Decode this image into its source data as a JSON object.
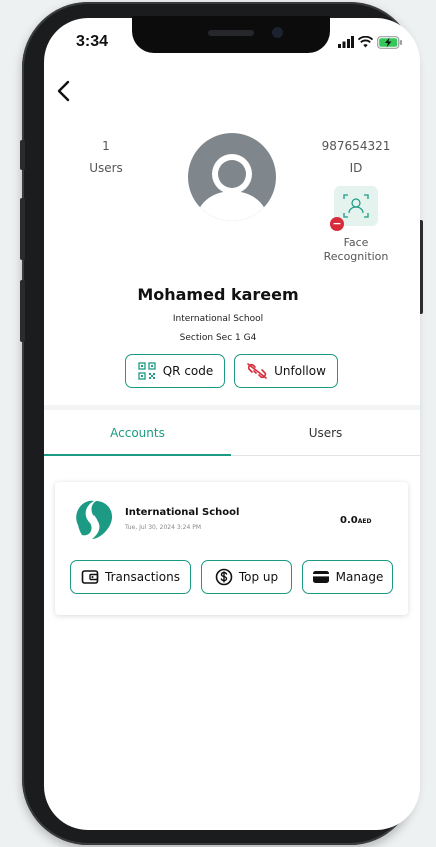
{
  "status": {
    "time": "3:34"
  },
  "profile": {
    "users_count": "1",
    "users_label": "Users",
    "id_value": "987654321",
    "id_label": "ID",
    "face_label_1": "Face",
    "face_label_2": "Recognition",
    "name": "Mohamed kareem",
    "school": "International School",
    "section": "Section  Sec 1 G4"
  },
  "actions": {
    "qr_label": "QR code",
    "unfollow_label": "Unfollow"
  },
  "tabs": [
    {
      "label": "Accounts",
      "active": true
    },
    {
      "label": "Users",
      "active": false
    }
  ],
  "account_card": {
    "title": "International School",
    "date": "Tue, Jul 30, 2024 3:24 PM",
    "amount": "0.0",
    "currency": "AED",
    "buttons": {
      "transactions": "Transactions",
      "top_up": "Top up",
      "manage": "Manage"
    }
  },
  "colors": {
    "accent": "#1c9a83",
    "danger": "#d82c3b"
  }
}
